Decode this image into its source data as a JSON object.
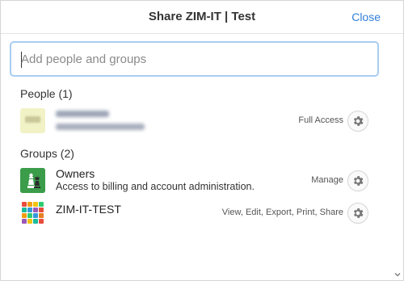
{
  "dialog": {
    "title": "Share ZIM-IT | Test",
    "close_label": "Close"
  },
  "search": {
    "placeholder": "Add people and groups",
    "value": ""
  },
  "people": {
    "heading": "People (1)",
    "items": [
      {
        "permission": "Full Access"
      }
    ]
  },
  "groups": {
    "heading": "Groups (2)",
    "items": [
      {
        "name": "Owners",
        "description": "Access to billing and account administration.",
        "permission": "Manage"
      },
      {
        "name": "ZIM-IT-TEST",
        "permission": "View, Edit, Export, Print, Share"
      }
    ]
  },
  "icons": {
    "settings": "gear-icon",
    "owner_avatar": "chess-pieces-icon",
    "group_avatar": "color-grid-icon",
    "scroll_down": "chevron-down-icon"
  },
  "colors": {
    "accent": "#2f7fd8",
    "focus_border": "#a8cdf1",
    "owner_avatar_bg": "#3b9c4a"
  }
}
